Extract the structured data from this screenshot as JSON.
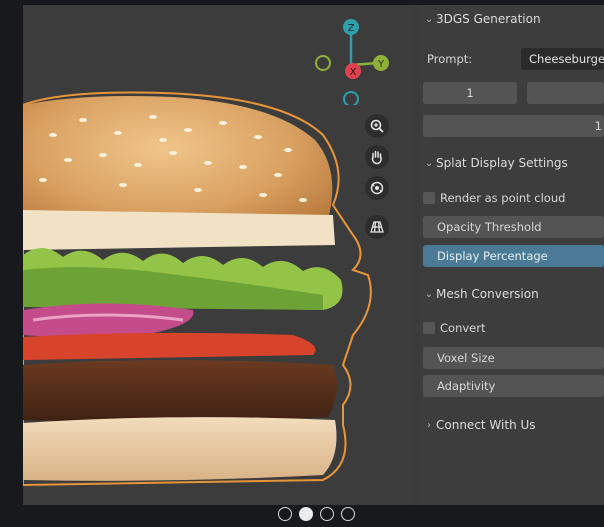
{
  "gizmo": {
    "z_label": "Z",
    "x_label": "X",
    "y_label": "Y"
  },
  "viewport_tools": [
    {
      "name": "zoom-icon"
    },
    {
      "name": "pan-hand-icon"
    },
    {
      "name": "camera-orbit-icon"
    },
    {
      "name": "grid-view-icon"
    }
  ],
  "panel": {
    "generation": {
      "title": "3DGS Generation",
      "prompt_label": "Prompt:",
      "prompt_value": "Cheeseburger",
      "field1_value": "1",
      "field2_value": "",
      "wide_field_value": "1"
    },
    "splat": {
      "title": "Splat Display Settings",
      "point_cloud_label": "Render as point cloud",
      "point_cloud_checked": false,
      "opacity_label": "Opacity Threshold",
      "display_label": "Display Percentage"
    },
    "mesh": {
      "title": "Mesh Conversion",
      "convert_label": "Convert",
      "convert_checked": false,
      "voxel_label": "Voxel Size",
      "adaptivity_label": "Adaptivity"
    },
    "connect": {
      "title": "Connect With Us"
    }
  },
  "carousel": {
    "count": 4,
    "active_index": 1
  },
  "colors": {
    "accent": "#4a7a95",
    "z_axis": "#2f9fab",
    "x_axis": "#e0434f",
    "y_axis": "#8fb13a"
  }
}
